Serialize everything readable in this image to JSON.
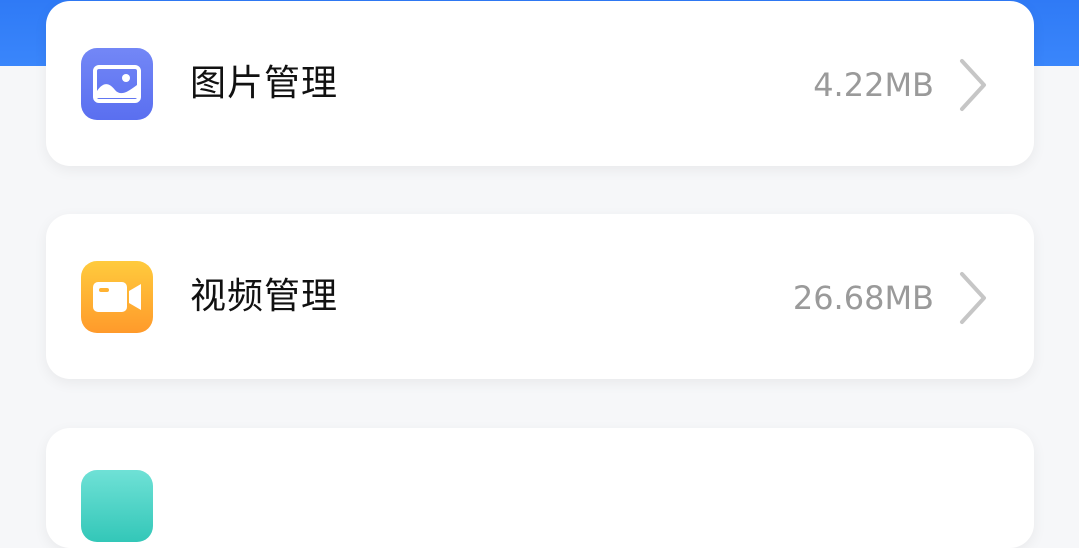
{
  "colors": {
    "banner": "#3a86fb",
    "image_icon": "#6379f3",
    "video_icon": "#ffac30",
    "partial_icon": "#40ccbe",
    "label_text": "#111111",
    "size_text": "#9a9a9a",
    "chevron": "#c6c6c6"
  },
  "items": [
    {
      "icon": "image-icon",
      "label": "图片管理",
      "size": "4.22MB",
      "chevron": "chevron-right-icon"
    },
    {
      "icon": "video-icon",
      "label": "视频管理",
      "size": "26.68MB",
      "chevron": "chevron-right-icon"
    },
    {
      "icon": "app-icon"
    }
  ]
}
